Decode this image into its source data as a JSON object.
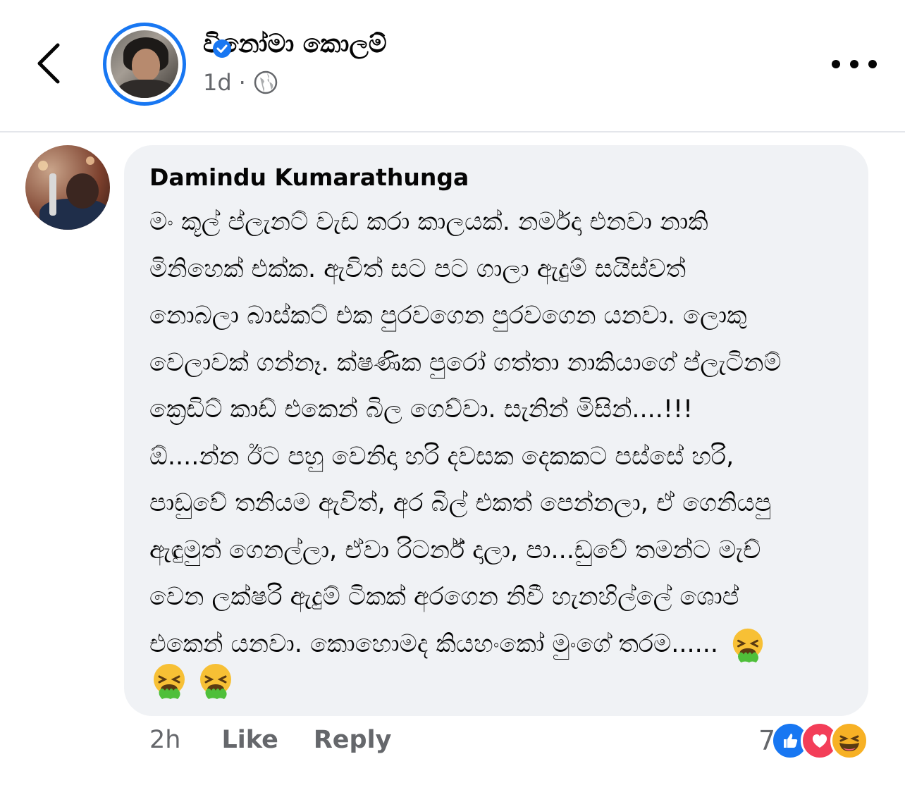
{
  "header": {
    "page_name": "වි‍නෝමා කොලම්",
    "time": "1d",
    "separator": "·",
    "privacy_icon": "globe-icon"
  },
  "comment": {
    "author": "Damindu Kumarathunga",
    "lines": [
      "මං කූල් ප්ලැනට් වැඩ කරා කාලයක්. නර්මදා එනවා නාකි",
      "මිනිහෙක් එක්ක. ඇවිත් සට පට ගාලා ඇදුම් සයිස්වත්",
      "නොබලා බාස්කට් එක පුරවගෙන පුරවගෙන යනවා. ලොකු",
      "වෙලාවක් ගන්නෑ. ක්ෂණික පුරෝ ගත්තා නාකියාගේ ප්ලැටිනම්",
      "ක්‍රෙඩිට් කාඩ් එකෙන් බිල ගෙව්වා. සැනින් මිසින්....!!!",
      "ඕ....න්න ඊට පහු වෙනිදා හරි දවසක දෙකකට පස්සේ හරි,",
      "පාඩුවේ තනියම ඇවිත්, අර බිල් එකත් පෙන්නලා, ඒ ගෙනියපු",
      "ඇඳුමුත් ගෙනල්ලා, ඒවා රිටර්න් දාලා, පා...ඩුවේ තමන්ට මැච්",
      "වෙන ලක්ෂරි ඇදුම් ටිකක් අරගෙන නිවී හැනහිල්ලේ ශොප්",
      "එකෙන් යනවා. කොහොමද කියහංකෝ මුංගේ තරම......"
    ],
    "emoji_name": "vomiting-face",
    "time": "2h",
    "like_label": "Like",
    "reply_label": "Reply",
    "reaction_count": "7",
    "reactions": [
      "like",
      "love",
      "haha"
    ]
  },
  "colors": {
    "accent": "#1877f2",
    "bubble": "#f0f2f5",
    "muted": "#65676b",
    "love": "#f33e58",
    "haha": "#f7b125"
  }
}
